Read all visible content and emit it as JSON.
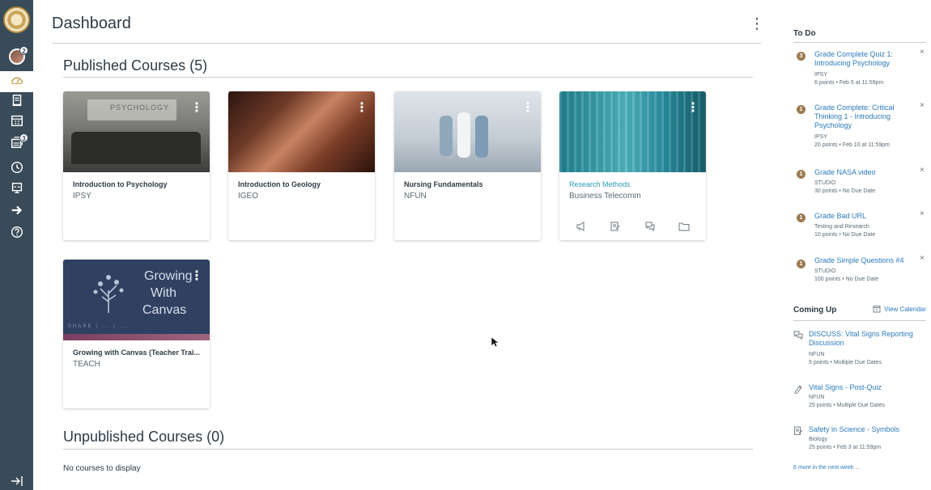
{
  "header": {
    "title": "Dashboard"
  },
  "sections": {
    "published": "Published Courses (5)",
    "unpublished": "Unpublished Courses (0)",
    "no_courses": "No courses to display"
  },
  "nav": {
    "inbox_badge": "2",
    "courses_badge": "3"
  },
  "courses": [
    {
      "title": "Introduction to Psychology",
      "code": "IPSY",
      "hero_text": "PSYCHOLOGY"
    },
    {
      "title": "Introduction to Geology",
      "code": "IGEO"
    },
    {
      "title": "Nursing Fundamentals",
      "code": "NFUN"
    },
    {
      "title": "Research Methods",
      "code": "Business Telecomm"
    },
    {
      "title": "Growing with Canvas (Teacher Trai...",
      "code": "TEACH",
      "hero_line1": "Growing",
      "hero_line2": "With",
      "hero_line3": "Canvas",
      "hero_strip": "SHARE | ... | ..."
    }
  ],
  "todo": {
    "title": "To Do",
    "items": [
      {
        "badge": "3",
        "link": "Grade Complete Quiz 1: Introducing Psychology",
        "course": "IPSY",
        "meta": "6 points • Feb 5 at 11:59pm"
      },
      {
        "badge": "1",
        "link": "Grade Complete: Critical Thinking 1 - Introducing Psychology",
        "course": "IPSY",
        "meta": "20 points • Feb 10 at 11:59pm"
      },
      {
        "badge": "1",
        "link": "Grade NASA video",
        "course": "STUDIO",
        "meta": "30 points • No Due Date"
      },
      {
        "badge": "1",
        "link": "Grade Bad URL",
        "course": "Testing and Research",
        "meta": "10 points • No Due Date"
      },
      {
        "badge": "1",
        "link": "Grade Simple Questions #4",
        "course": "STUDIO",
        "meta": "100 points • No Due Date"
      }
    ]
  },
  "coming_up": {
    "title": "Coming Up",
    "view_calendar": "View Calendar",
    "items": [
      {
        "icon": "discussion-icon",
        "link": "DISCUSS: Vital Signs Reporting Discussion",
        "course": "NFUN",
        "meta": "5 points • Multiple Due Dates"
      },
      {
        "icon": "quiz-icon",
        "link": "Vital Signs - Post-Quiz",
        "course": "NFUN",
        "meta": "25 points • Multiple Due Dates"
      },
      {
        "icon": "assignment-icon",
        "link": "Safety in Science - Symbols",
        "course": "Biology",
        "meta": "25 points • Feb 3 at 11:59pm"
      }
    ],
    "more": "6 more in the next week ..."
  },
  "colors": {
    "nav_bg": "#394b58",
    "link": "#2b7abc",
    "research_title": "#2d9ab3",
    "todo_badge": "#9b7b52"
  }
}
